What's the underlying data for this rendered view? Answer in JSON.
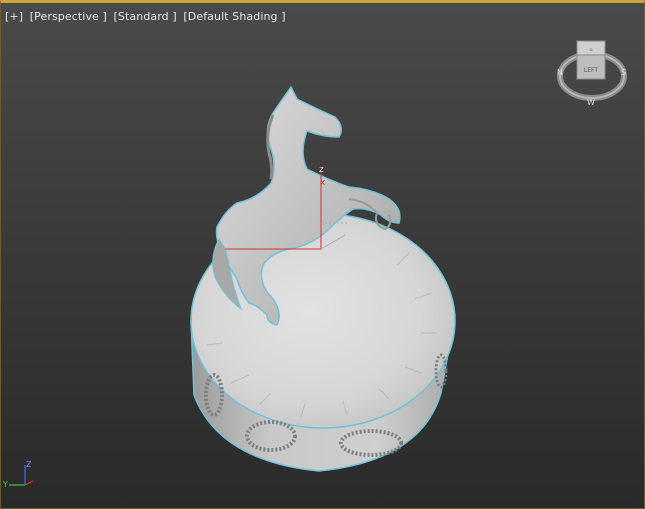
{
  "viewport": {
    "labels": [
      "[+]",
      "[Perspective ]",
      "[Standard ]",
      "[Default Shading ]"
    ]
  },
  "viewcube": {
    "face_label": "LEFT",
    "compass": {
      "north": "N",
      "south": "S",
      "west": "W"
    }
  },
  "gizmo": {
    "z_label": "z",
    "x_label": "x"
  },
  "axis_tripod": {
    "z_label": "Z",
    "y_label": "Y",
    "x_label": "X"
  },
  "colors": {
    "selection_outline": "#6fc3d8",
    "axis_x": "#d03030",
    "axis_y": "#2fae2f",
    "axis_z": "#3a5fd0",
    "viewport_border_active": "#c9a63a"
  }
}
